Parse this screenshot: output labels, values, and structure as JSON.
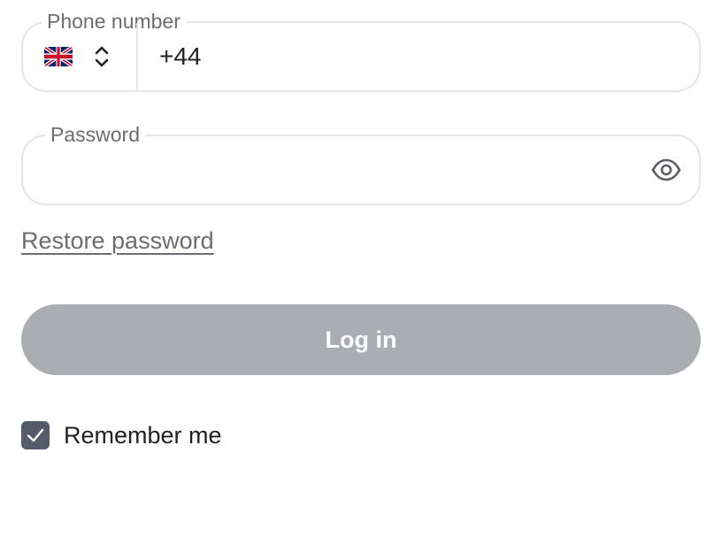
{
  "phone_field": {
    "label": "Phone number",
    "country_flag": "uk-flag-icon",
    "country_selector_icon": "chevron-up-down-icon",
    "value": "+44"
  },
  "password_field": {
    "label": "Password",
    "value": "",
    "toggle_icon": "eye-icon"
  },
  "restore_link": "Restore password",
  "login_button": {
    "label": "Log in",
    "disabled": true,
    "color": "#aaadb2"
  },
  "remember_me": {
    "label": "Remember me",
    "checked": true,
    "color": "#545c6c"
  }
}
